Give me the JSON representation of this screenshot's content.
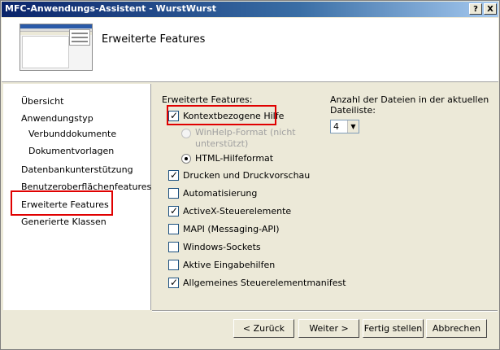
{
  "window": {
    "title": "MFC-Anwendungs-Assistent - WurstWurst",
    "help_button": "?",
    "close_button": "X"
  },
  "header": {
    "page_title": "Erweiterte Features"
  },
  "sidebar": {
    "items": [
      {
        "label": "Übersicht"
      },
      {
        "label": "Anwendungstyp"
      },
      {
        "label": "Verbunddokumente"
      },
      {
        "label": "Dokumentvorlagen"
      },
      {
        "label": "Datenbankunterstützung"
      },
      {
        "label": "Benutzeroberflächenfeatures"
      },
      {
        "label": "Erweiterte Features",
        "selected": true
      },
      {
        "label": "Generierte Klassen"
      }
    ]
  },
  "features": {
    "group_label": "Erweiterte Features:",
    "context_help": {
      "label": "Kontextbezogene Hilfe",
      "checked": true
    },
    "winhelp": {
      "label_line1": "WinHelp-Format (nicht",
      "label_line2": "unterstützt)",
      "selected": false,
      "enabled": false
    },
    "htmlhelp": {
      "label": "HTML-Hilfeformat",
      "selected": true
    },
    "items": [
      {
        "label": "Drucken und Druckvorschau",
        "checked": true
      },
      {
        "label": "Automatisierung",
        "checked": false
      },
      {
        "label": "ActiveX-Steuerelemente",
        "checked": true
      },
      {
        "label": "MAPI (Messaging-API)",
        "checked": false
      },
      {
        "label": "Windows-Sockets",
        "checked": false
      },
      {
        "label": "Aktive Eingabehilfen",
        "checked": false
      },
      {
        "label": "Allgemeines Steuerelementmanifest",
        "checked": true
      }
    ]
  },
  "recent_files": {
    "label_line1": "Anzahl der Dateien in der aktuellen",
    "label_line2": "Dateiliste:",
    "value": "4"
  },
  "buttons": {
    "back": "< Zurück",
    "next": "Weiter >",
    "finish": "Fertig stellen",
    "cancel": "Abbrechen"
  }
}
